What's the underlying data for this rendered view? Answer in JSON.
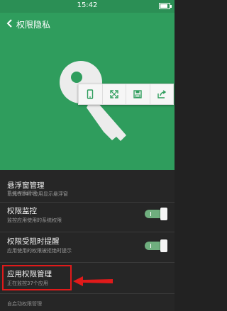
{
  "status_bar": {
    "time": "15:42"
  },
  "header": {
    "title": "权限隐私"
  },
  "toolbar": {
    "items": [
      "phone-icon",
      "expand-icon",
      "save-icon",
      "share-icon"
    ]
  },
  "settings": {
    "floating_window": {
      "title": "悬浮窗管理",
      "subtitle": "已允许24个应用显示悬浮窗"
    },
    "section_system": "系统权限管理",
    "permission_monitor": {
      "title": "权限监控",
      "subtitle": "监控应用使用的系统权限",
      "enabled": true
    },
    "permission_blocked": {
      "title": "权限受阻时提醒",
      "subtitle": "应用使用的权限被拒绝时提示",
      "enabled": true
    },
    "app_permissions": {
      "title": "应用权限管理",
      "subtitle": "正在监控37个应用"
    },
    "section_autostart": "自启动权限管理"
  },
  "colors": {
    "header_green": "#2f9d5d",
    "highlight_red": "#e01a1a"
  }
}
